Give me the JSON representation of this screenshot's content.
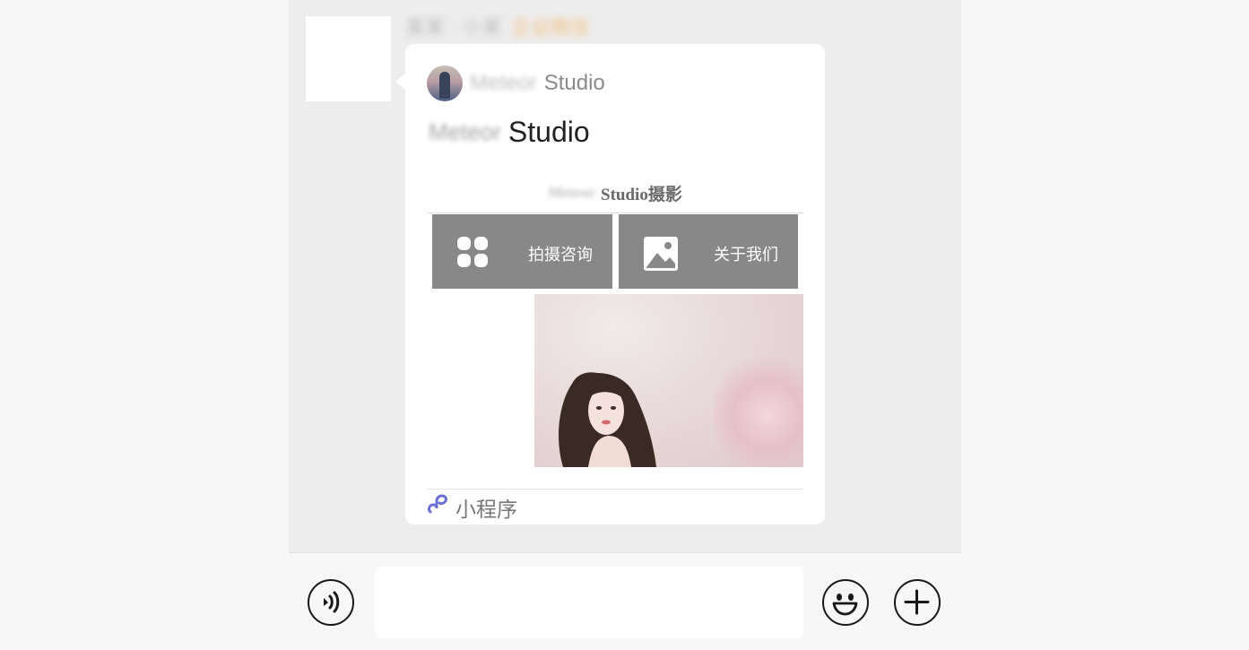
{
  "header": {
    "sender_name": "某某 · 小某",
    "sender_tag": "企业微信"
  },
  "card": {
    "source_name_blurred": "Meteor",
    "source_name": "Studio",
    "title_blurred": "Meteor",
    "title": "Studio",
    "preview": {
      "heading_blurred": "Meteor",
      "heading": "Studio摄影",
      "tiles": [
        {
          "label": "拍摄咨询",
          "icon": "grid-icon"
        },
        {
          "label": "关于我们",
          "icon": "image-icon"
        }
      ]
    },
    "footer_label": "小程序",
    "footer_icon": "mini-program-icon"
  },
  "input_bar": {
    "voice_icon": "voice-icon",
    "emoji_icon": "emoji-icon",
    "plus_icon": "plus-icon",
    "input_value": ""
  },
  "colors": {
    "chat_background": "#ededed",
    "tile_gray": "#888888",
    "mini_program_accent": "#6b6fd6"
  }
}
